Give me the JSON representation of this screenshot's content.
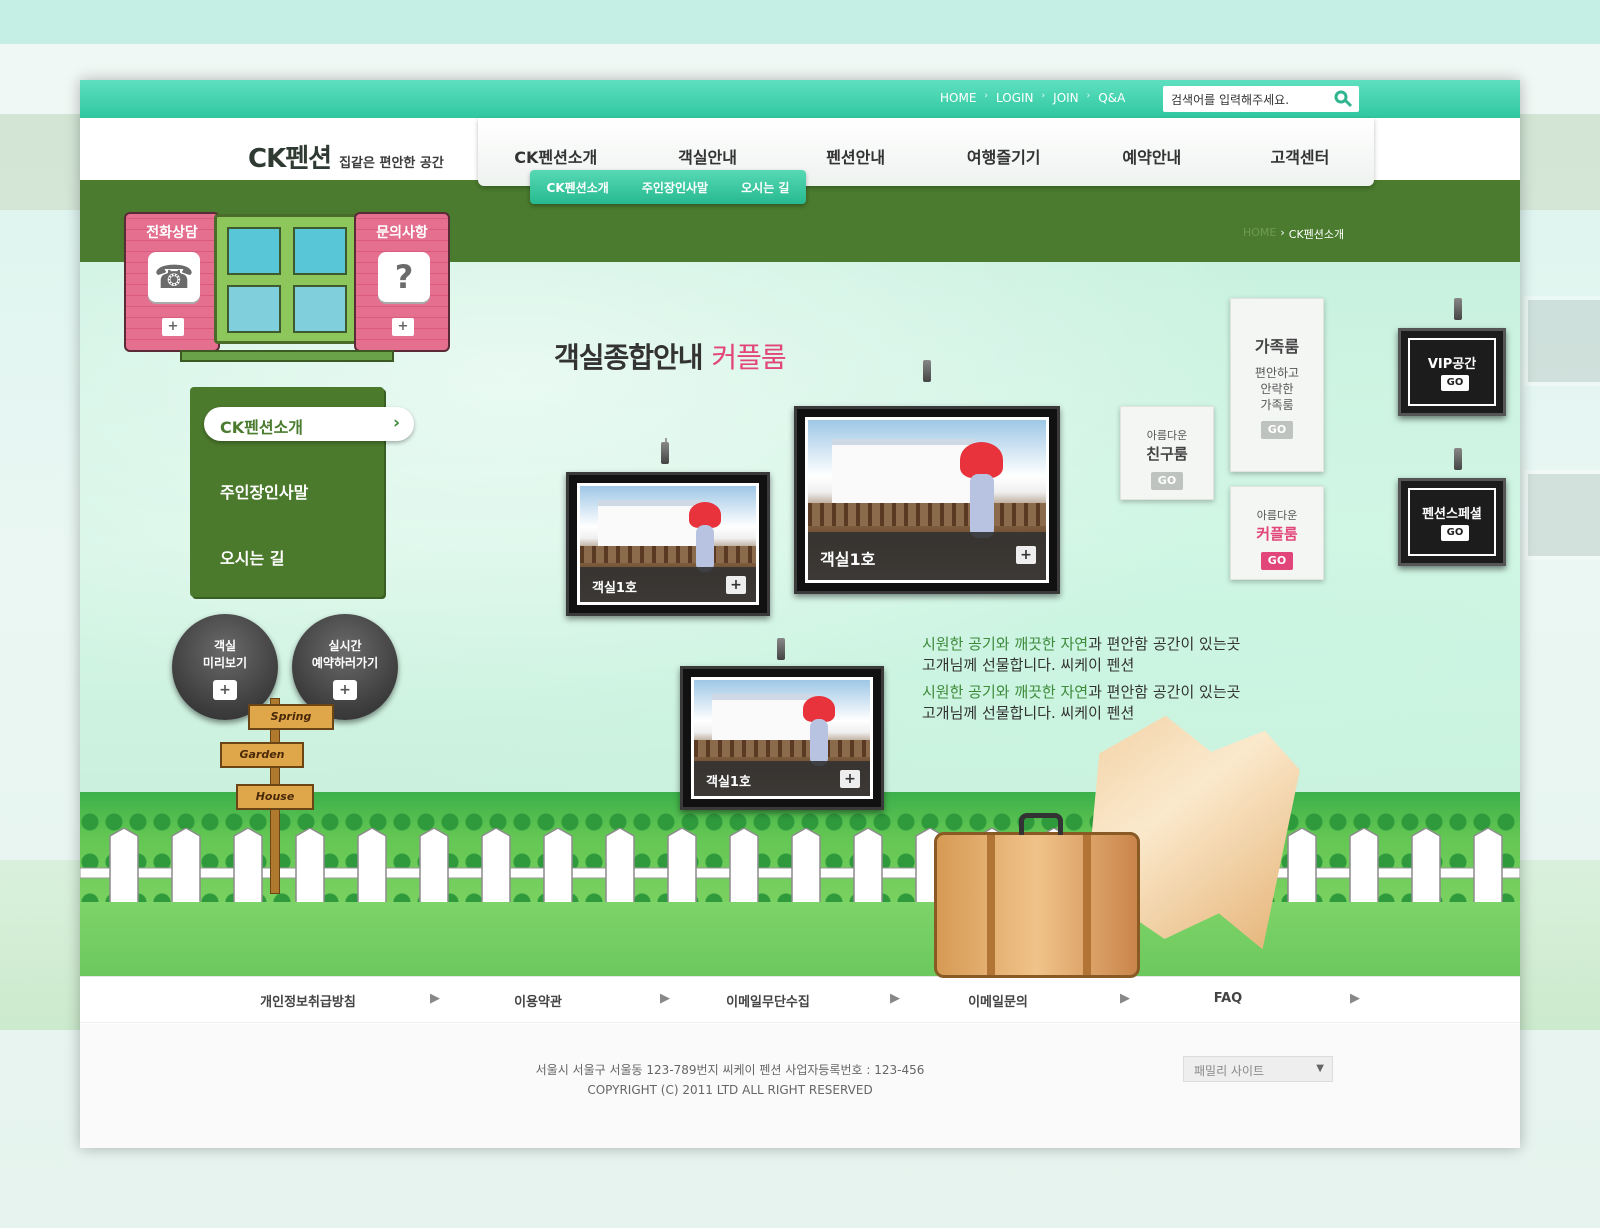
{
  "top": {
    "links": [
      "HOME",
      "LOGIN",
      "JOIN",
      "Q&A"
    ],
    "search_value": "검색어를 입력해주세요."
  },
  "logo": {
    "brand": "CK펜션",
    "tagline": "집같은 편안한 공간"
  },
  "nav": {
    "items": [
      "CK펜션소개",
      "객실안내",
      "펜션안내",
      "여행즐기기",
      "예약안내",
      "고객센터"
    ],
    "subitems": [
      "CK펜션소개",
      "주인장인사말",
      "오시는 길"
    ]
  },
  "breadcrumb": {
    "home": "HOME",
    "sep": "›",
    "current": "CK펜션소개"
  },
  "signboard": {
    "left_label": "전화상담",
    "right_label": "문의사항",
    "plus": "+"
  },
  "leftmenu": {
    "active": "CK펜션소개",
    "items": [
      "주인장인사말",
      "오시는 길"
    ]
  },
  "circle_buttons": [
    {
      "line1": "객실",
      "line2": "미리보기"
    },
    {
      "line1": "실시간",
      "line2": "예약하러가기"
    }
  ],
  "signpost": [
    "Spring",
    "Garden",
    "House"
  ],
  "title": {
    "main": "객실종합안내",
    "accent": "커플룸"
  },
  "frames": [
    {
      "caption": "객실1호"
    },
    {
      "caption": "객실1호"
    },
    {
      "caption": "객실1호"
    }
  ],
  "cards": {
    "friend": {
      "small": "아름다운",
      "big": "친구룸",
      "go": "GO"
    },
    "family": {
      "big": "가족룸",
      "desc1": "편안하고",
      "desc2": "안락한",
      "desc3": "가족룸",
      "go": "GO"
    },
    "couple": {
      "small": "아름다운",
      "big": "커플룸",
      "go": "GO"
    },
    "vip": {
      "label": "VIP공간",
      "go": "GO"
    },
    "special": {
      "label": "펜션스페셜",
      "go": "GO"
    }
  },
  "tagline": {
    "l1_green": "시원한 공기와 깨끗한 자연",
    "l1_rest": "과 편안함 공간이 있는곳",
    "l2": "고개님께 선물합니다. 씨케이 펜션",
    "l3_green": "시원한 공기와 깨끗한 자연",
    "l3_rest": "과 편안함 공간이 있는곳",
    "l4": "고개님께 선물합니다. 씨케이 펜션"
  },
  "footer": {
    "links": [
      "개인정보취급방침",
      "이용약관",
      "이메일무단수집",
      "이메일문의",
      "FAQ"
    ],
    "address": "서울시 서울구 서울동 123-789번지 씨케이 펜션 사업자등록번호 : 123-456",
    "copyright": "COPYRIGHT (C) 2011 LTD ALL RIGHT RESERVED",
    "family_site": "패밀리 사이트"
  },
  "colors": {
    "topbar": "#2fc79f",
    "band": "#4a7b2e",
    "accent_pink": "#e2457a"
  }
}
